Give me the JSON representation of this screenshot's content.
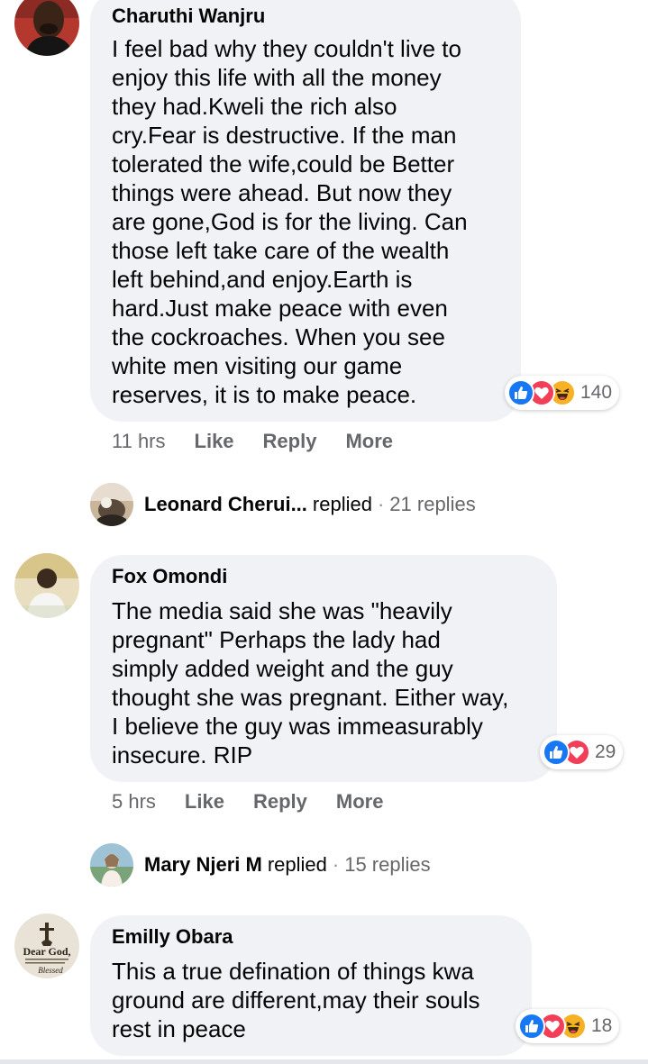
{
  "comments": [
    {
      "author": "Charuthi Wanjru",
      "text": "I feel bad why they couldn't live to\nenjoy this life with all the money\nthey had.Kweli the rich also\ncry.Fear is destructive. If the man\ntolerated the wife,could be Better\nthings were ahead. But now they\nare gone,God is for the living. Can\nthose left take care of the wealth\nleft behind,and enjoy.Earth is\nhard.Just make peace with even\nthe cockroaches. When you see\nwhite men visiting our game\nreserves, it is to make peace.",
      "reactions": [
        "like-icon",
        "love-icon",
        "haha-icon"
      ],
      "reaction_count": "140",
      "time": "11 hrs",
      "like_label": "Like",
      "reply_label": "Reply",
      "more_label": "More",
      "reply_summary": {
        "name": "Leonard Cherui...",
        "verb": "replied",
        "sep": "·",
        "count": "21 replies"
      }
    },
    {
      "author": "Fox Omondi",
      "text": "The media said she was \"heavily\npregnant\" Perhaps the lady had\nsimply added weight and the guy\nthought she was pregnant. Either way,\nI believe the guy was immeasurably\ninsecure. RIP",
      "reactions": [
        "like-icon",
        "love-icon"
      ],
      "reaction_count": "29",
      "time": "5 hrs",
      "like_label": "Like",
      "reply_label": "Reply",
      "more_label": "More",
      "reply_summary": {
        "name": "Mary Njeri M",
        "verb": "replied",
        "sep": "·",
        "count": "15 replies"
      }
    },
    {
      "author": "Emilly Obara",
      "avatar_text": "Dear God,",
      "avatar_subtext": "Blessed",
      "text": "This a true defination of things kwa\nground are different,may their souls\nrest in peace",
      "reactions": [
        "like-icon",
        "love-icon",
        "haha-icon"
      ],
      "reaction_count": "18"
    }
  ],
  "colors": {
    "bubble": "#f0f2f5",
    "like_blue": "#1877f2",
    "love_red": "#f33e58",
    "haha_yellow": "#f7b125",
    "secondary_text": "#65676b"
  }
}
